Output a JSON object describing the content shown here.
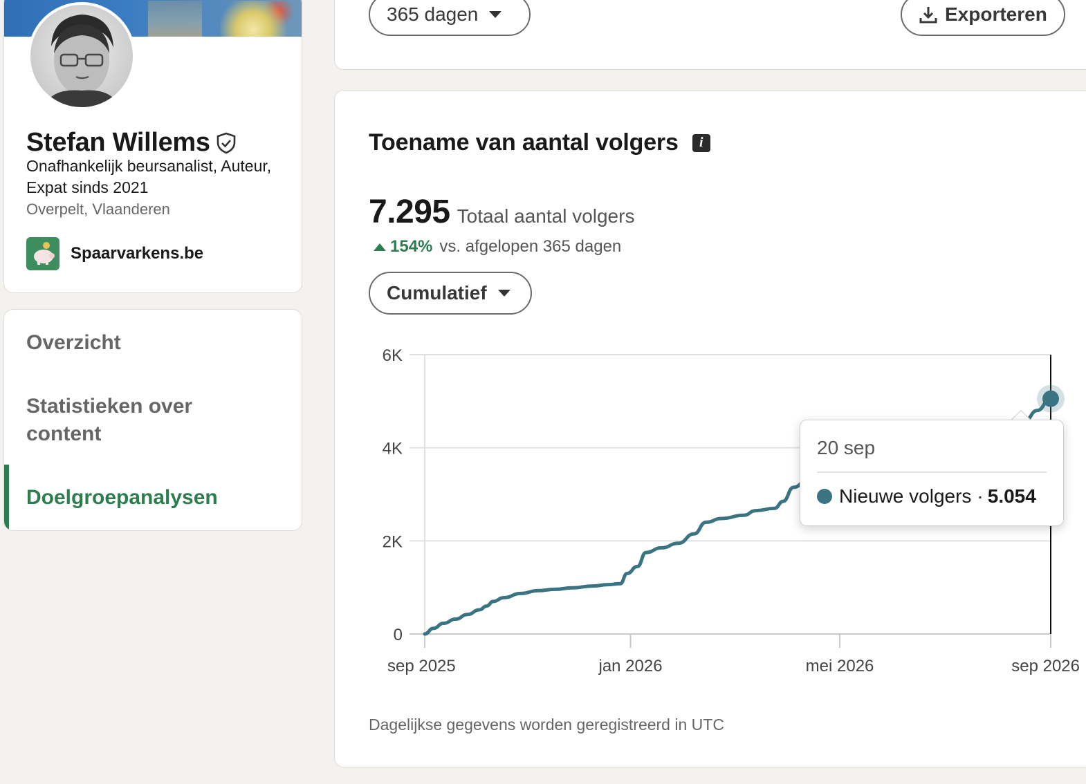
{
  "profile": {
    "name": "Stefan Willems",
    "headline": "Onafhankelijk beursanalist, Auteur, Expat sinds 2021",
    "location": "Overpelt, Vlaanderen",
    "company": "Spaarvarkens.be"
  },
  "nav": {
    "items": [
      {
        "label": "Overzicht",
        "active": false
      },
      {
        "label": "Statistieken over content",
        "active": false
      },
      {
        "label": "Doelgroepanalysen",
        "active": true
      }
    ]
  },
  "toolbar": {
    "period": "365 dagen",
    "export": "Exporteren"
  },
  "card": {
    "title": "Toename van aantal volgers",
    "total_value": "7.295",
    "total_label": "Totaal aantal volgers",
    "delta_value": "154%",
    "delta_label": "vs. afgelopen 365 dagen",
    "mode": "Cumulatief",
    "footnote": "Dagelijkse gegevens worden geregistreerd in UTC"
  },
  "tooltip": {
    "date": "20 sep",
    "series": "Nieuwe volgers",
    "separator": "·",
    "value": "5.054"
  },
  "colors": {
    "accent_green": "#2e7d4f",
    "series": "#3a7381"
  },
  "chart_data": {
    "type": "line",
    "xlabel": "",
    "ylabel": "",
    "x_ticks": [
      "sep 2025",
      "jan 2026",
      "mei 2026",
      "sep 2026"
    ],
    "y_ticks": [
      "0",
      "2K",
      "4K",
      "6K"
    ],
    "ylim": [
      0,
      6000
    ],
    "grid": true,
    "series": [
      {
        "name": "Nieuwe volgers",
        "points": [
          [
            "2025-09-20",
            0
          ],
          [
            "2025-09-25",
            120
          ],
          [
            "2025-10-01",
            230
          ],
          [
            "2025-10-08",
            320
          ],
          [
            "2025-10-15",
            420
          ],
          [
            "2025-10-22",
            520
          ],
          [
            "2025-10-26",
            600
          ],
          [
            "2025-10-30",
            700
          ],
          [
            "2025-11-05",
            780
          ],
          [
            "2025-11-15",
            870
          ],
          [
            "2025-11-25",
            930
          ],
          [
            "2025-12-05",
            960
          ],
          [
            "2025-12-15",
            990
          ],
          [
            "2025-12-27",
            1030
          ],
          [
            "2026-01-05",
            1060
          ],
          [
            "2026-01-12",
            1080
          ],
          [
            "2026-01-16",
            1300
          ],
          [
            "2026-01-22",
            1450
          ],
          [
            "2026-01-27",
            1750
          ],
          [
            "2026-02-05",
            1850
          ],
          [
            "2026-02-15",
            1950
          ],
          [
            "2026-02-24",
            2150
          ],
          [
            "2026-03-03",
            2400
          ],
          [
            "2026-03-12",
            2480
          ],
          [
            "2026-03-25",
            2550
          ],
          [
            "2026-04-01",
            2650
          ],
          [
            "2026-04-12",
            2700
          ],
          [
            "2026-04-17",
            2850
          ],
          [
            "2026-04-23",
            3150
          ],
          [
            "2026-05-01",
            3300
          ],
          [
            "2026-05-10",
            3350
          ],
          [
            "2026-05-20",
            3450
          ],
          [
            "2026-06-05",
            3700
          ],
          [
            "2026-07-01",
            4100
          ],
          [
            "2026-08-01",
            4380
          ],
          [
            "2026-08-25",
            4480
          ],
          [
            "2026-09-05",
            4580
          ],
          [
            "2026-09-12",
            4800
          ],
          [
            "2026-09-20",
            5054
          ]
        ]
      }
    ],
    "highlight": {
      "x": "2026-09-20",
      "y": 5054
    }
  }
}
